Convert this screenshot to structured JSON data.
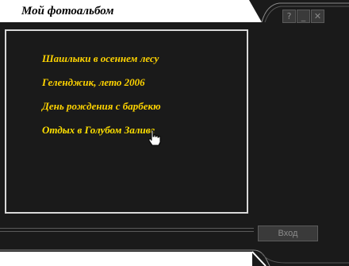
{
  "window": {
    "title": "Мой фотоальбом",
    "controls": [
      {
        "name": "help",
        "glyph": "?"
      },
      {
        "name": "minimize",
        "glyph": "_"
      },
      {
        "name": "close",
        "glyph": "✕"
      }
    ]
  },
  "albums": [
    "Шашлыки в осеннем лесу",
    "Геленджик, лето 2006",
    "День рождения с барбекю",
    "Отдых в Голубом Заливе"
  ],
  "login_button": "Вход",
  "colors": {
    "background": "#1a1a1a",
    "album_text": "#ffd400",
    "title_tab": "#ffffff"
  }
}
